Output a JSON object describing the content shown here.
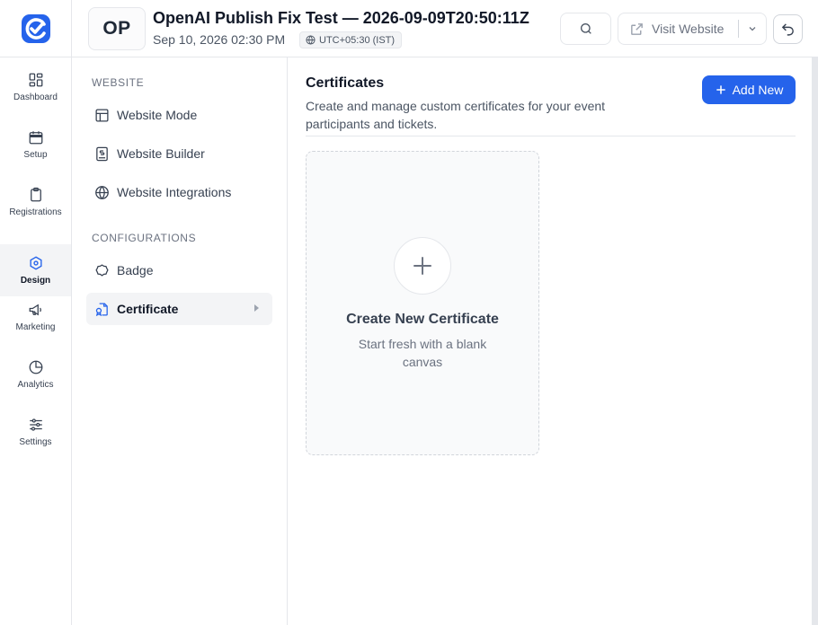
{
  "event": {
    "initials": "OP",
    "title": "OpenAI Publish Fix Test — 2026-09-09T20:50:11Z",
    "date": "Sep 10, 2026 02:30 PM",
    "timezone": "UTC+05:30 (IST)"
  },
  "header": {
    "visit_label": "Visit Website"
  },
  "rail": [
    {
      "label": "Dashboard",
      "icon": "dashboard-icon"
    },
    {
      "label": "Setup",
      "icon": "calendar-icon"
    },
    {
      "label": "Registrations",
      "icon": "clipboard-icon"
    },
    {
      "label": "Design",
      "icon": "palette-icon",
      "active": true
    },
    {
      "label": "Marketing",
      "icon": "megaphone-icon"
    },
    {
      "label": "Analytics",
      "icon": "pie-chart-icon"
    },
    {
      "label": "Settings",
      "icon": "sliders-icon"
    }
  ],
  "subnav": {
    "website_heading": "WEBSITE",
    "website_items": [
      "Website Mode",
      "Website Builder",
      "Website Integrations"
    ],
    "config_heading": "CONFIGURATIONS",
    "config_items": [
      "Badge",
      "Certificate"
    ],
    "active_item": "Certificate"
  },
  "main": {
    "title": "Certificates",
    "description": "Create and manage custom certificates for your event participants and tickets.",
    "add_button": "Add New",
    "create_card": {
      "title": "Create New Certificate",
      "subtitle": "Start fresh with a blank canvas"
    }
  },
  "colors": {
    "brand": "#2563eb",
    "active_bg": "#f3f4f6",
    "border": "#e5e7eb"
  }
}
